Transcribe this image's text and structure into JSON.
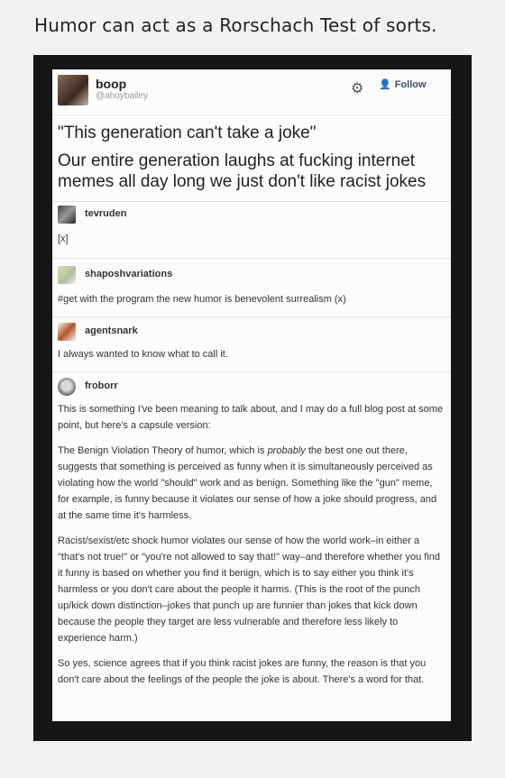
{
  "caption": "Humor can act as a Rorschach Test of sorts.",
  "post": {
    "username": "boop",
    "handle": "@ahoybailey",
    "follow_label": "Follow",
    "quote": "\"This generation can't take a joke\"",
    "text": "Our entire generation laughs at fucking internet memes all day long we just don't like racist jokes"
  },
  "replies": [
    {
      "user": "tevruden",
      "body": "[x]"
    },
    {
      "user": "shaposhvariations",
      "body": "#get with the program the new humor is benevolent surrealism (x)"
    },
    {
      "user": "agentsnark",
      "body": "I always wanted to know what to call it."
    },
    {
      "user": "froborr",
      "p1": "This is something I've been meaning to talk about, and I may do a full blog post at some point, but here's a capsule version:",
      "p2_a": "The Benign Violation Theory of humor, which is ",
      "p2_em": "probably",
      "p2_b": " the best one out there, suggests that something is perceived as funny when it is simultaneously perceived as violating how the world \"should\" work and as benign. Something like the \"gun\" meme, for example, is funny because it violates our sense of how a joke should progress, and at the same time it's harmless.",
      "p3": "Racist/sexist/etc shock humor violates our sense of how the world work–in either a \"that's not true!\" or \"you're not allowed to say that!\" way–and therefore whether you find it funny is based on whether you find it benign, which is to say either you think it's harmless or you don't care about the people it harms. (This is the root of the punch up/kick down distinction–jokes that punch up are funnier than jokes that kick down because the people they target are less vulnerable and therefore less likely to experience harm.)",
      "p4": "So yes, science agrees that if you think racist jokes are funny, the reason is that you don't care about the feelings of the people the joke is about. There's a word for that."
    }
  ],
  "icons": {
    "gear": "gear-icon",
    "follow": "add-user-icon"
  }
}
